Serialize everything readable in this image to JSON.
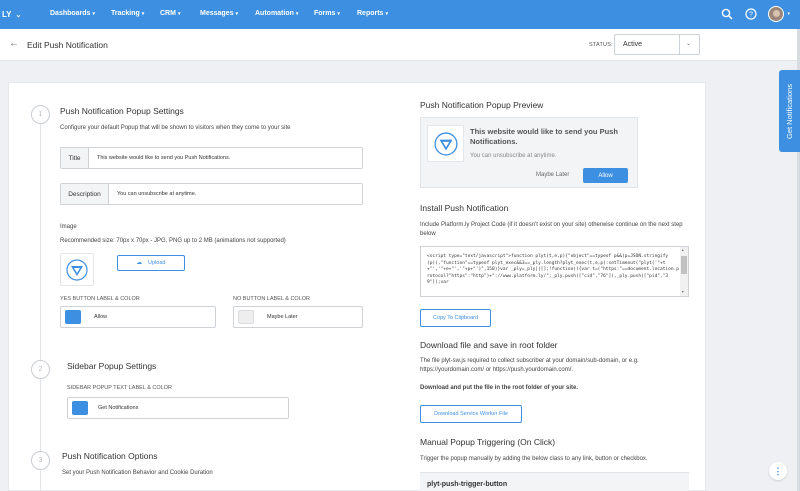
{
  "nav": {
    "brand": "LY",
    "items": [
      {
        "label": "Dashboards"
      },
      {
        "label": "Tracking"
      },
      {
        "label": "CRM"
      },
      {
        "label": "Messages"
      },
      {
        "label": "Automation"
      },
      {
        "label": "Forms"
      },
      {
        "label": "Reports"
      }
    ],
    "icons": [
      "search-icon",
      "help-icon",
      "avatar"
    ]
  },
  "header": {
    "title": "Edit Push Notification",
    "status_label": "STATUS:",
    "status_value": "Active"
  },
  "steps": [
    "1",
    "2",
    "3"
  ],
  "popup_settings": {
    "title": "Push Notification Popup Settings",
    "description": "Configure your default Popup that will be shown to visitors when they come to your site",
    "title_field_label": "Title",
    "title_field_value": "This website would like to send you Push Notifications.",
    "desc_field_label": "Description",
    "desc_field_value": "You can unsubscribe at anytime.",
    "image_label": "Image",
    "image_hint": "Recommended size: 70px x 70px - JPG, PNG up to 2 MB (animations not supported)",
    "upload_label": "Upload",
    "yes_label": "YES BUTTON LABEL & COLOR",
    "yes_value": "Allow",
    "yes_color": "#3d90e1",
    "no_label": "NO BUTTON LABEL & COLOR",
    "no_value": "Maybe Later",
    "no_color": "#f0f0f0"
  },
  "sidebar_settings": {
    "title": "Sidebar Popup Settings",
    "label": "SIDEBAR POPUP TEXT LABEL & COLOR",
    "value": "Get Notifications",
    "color": "#3d90e1"
  },
  "options": {
    "title": "Push Notification Options",
    "description": "Set your Push Notification Behavior and Cookie Duration"
  },
  "preview": {
    "title": "Push Notification Popup Preview",
    "heading": "This website would like to send you Push Notifications.",
    "sub": "You can unsubscribe at anytime.",
    "maybe": "Maybe Later",
    "allow": "Allow"
  },
  "install": {
    "title": "Install Push Notification",
    "description": "Include Platform.ly Project Code (if it doesn't exist on your site) otherwise continue on the next step below",
    "code": "<script type=\"text/javascript\">function plyt(t,e,p){\"object\"==typeof p&&(p=JSON.stringify(p)),\"function\"==typeof plyt_exec&&3==_ply.length?plyt_exec(t,e,p):setTimeout(\"plyt('\"+t+\"','\"+e+\"','\"+p+\"')\",150)}var _ply=_ply||[];!function(){var t=(\"https:\"==document.location.protocol?\"https\":\"http\")+\"://www.platform.ly/\";_ply.push([\"cid\",\"76\"]),_ply.push([\"pid\",\"39\"]);var",
    "copy_label": "Copy To Clipboard"
  },
  "download": {
    "title": "Download file and save in root folder",
    "description": "The file plyt-sw.js required to collect subscriber at your domain/sub-domain, or e.g. https://yourdomain.com/ or https://push.yourdomain.com/.",
    "bold_note": "Download and put the file in the root folder of your site.",
    "button_label": "Download Service Worker File"
  },
  "manual": {
    "title": "Manual Popup Triggering (On Click)",
    "description": "Trigger the popup manually by adding the below class to any link, button or checkbox.",
    "class_name": "plyt-push-trigger-button"
  },
  "side_tab": "Get Notifications",
  "colors": {
    "brand_blue": "#3d90e1"
  }
}
